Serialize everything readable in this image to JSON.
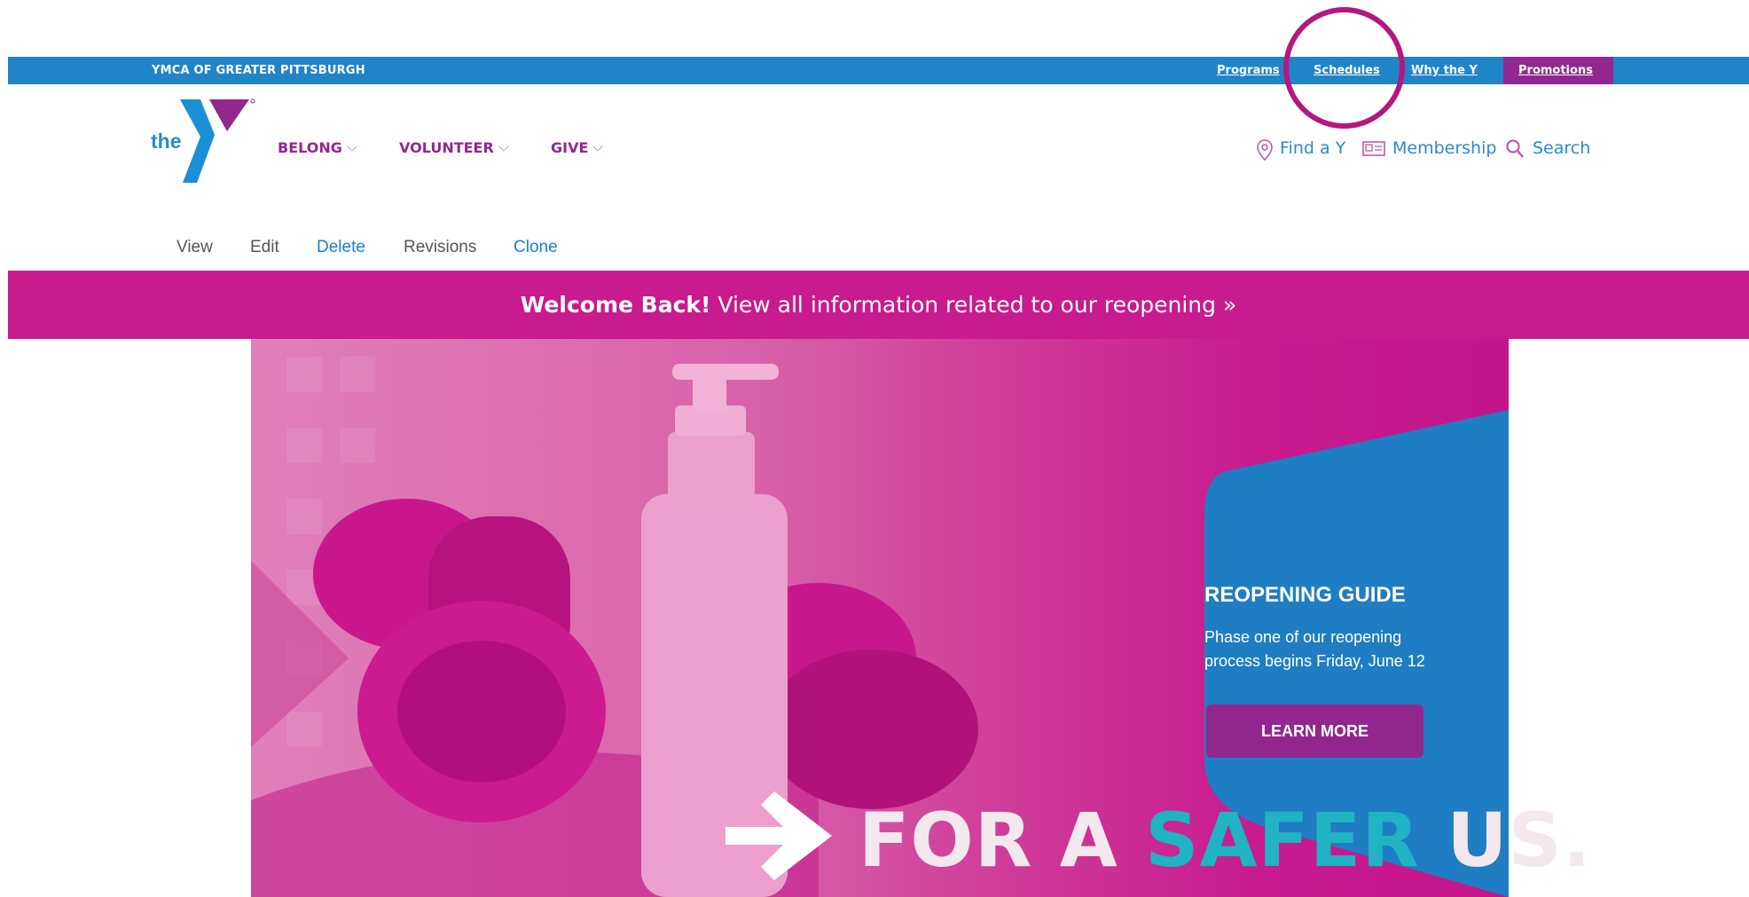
{
  "topbar": {
    "org": "YMCA OF GREATER PITTSBURGH",
    "links": [
      "Programs",
      "Schedules",
      "Why the Y"
    ],
    "promotions": "Promotions"
  },
  "logo": {
    "word": "the",
    "vertical": "YMCA"
  },
  "nav": {
    "items": [
      "BELONG",
      "VOLUNTEER",
      "GIVE"
    ],
    "find": "Find a Y",
    "membership": "Membership",
    "search": "Search"
  },
  "admin_tabs": [
    "View",
    "Edit",
    "Delete",
    "Revisions",
    "Clone"
  ],
  "welcome": {
    "bold": "Welcome Back!",
    "text": "View all information related to our reopening »"
  },
  "hero": {
    "guide_title": "REOPENING GUIDE",
    "guide_text": "Phase one of our reopening process begins Friday, June 12",
    "button": "LEARN MORE",
    "tagline_a": "FOR A",
    "tagline_b": "SAFER",
    "tagline_c": "US."
  },
  "colors": {
    "ymca_blue": "#2184c8",
    "ymca_purple": "#92278f",
    "banner_magenta": "#c71b8e",
    "teal": "#1fb3c4"
  }
}
